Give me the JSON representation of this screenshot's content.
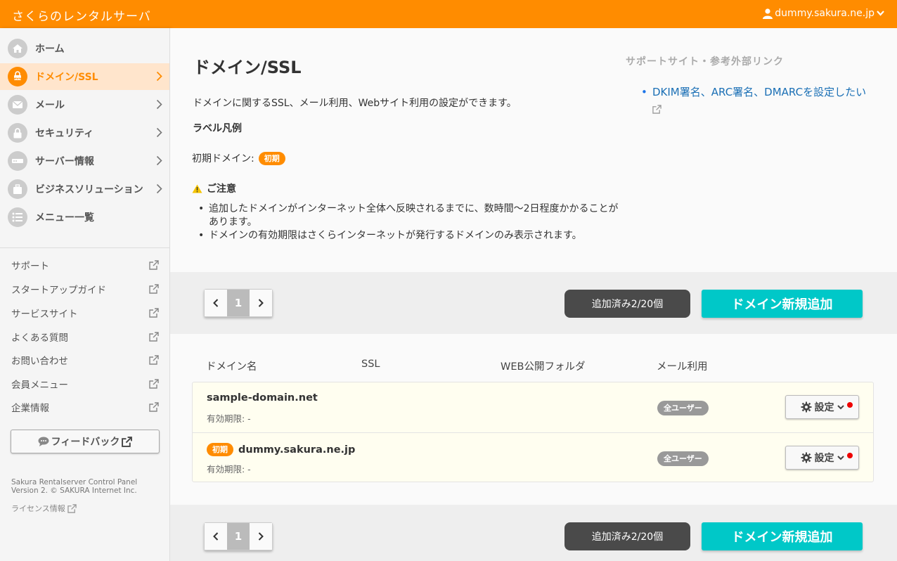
{
  "header": {
    "brand": "さくらのレンタルサーバ",
    "user": "dummy.sakura.ne.jp"
  },
  "sidebar": {
    "items": [
      {
        "label": "ホーム",
        "icon": "home-icon"
      },
      {
        "label": "ドメイン/SSL",
        "icon": "www-lock-icon",
        "active": true
      },
      {
        "label": "メール",
        "icon": "mail-icon"
      },
      {
        "label": "セキュリティ",
        "icon": "lock-icon"
      },
      {
        "label": "サーバー情報",
        "icon": "server-icon"
      },
      {
        "label": "ビジネスソリューション",
        "icon": "briefcase-icon"
      },
      {
        "label": "メニュー一覧",
        "icon": "list-icon"
      }
    ],
    "links": [
      "サポート",
      "スタートアップガイド",
      "サービスサイト",
      "よくある質問",
      "お問い合わせ",
      "会員メニュー",
      "企業情報"
    ],
    "feedback_label": "フィードバック",
    "footer_line1": "Sakura Rentalserver Control Panel",
    "footer_line2": "Version 2. © SAKURA Internet Inc.",
    "license_label": "ライセンス情報"
  },
  "main": {
    "title": "ドメイン/SSL",
    "description": "ドメインに関するSSL、メール利用、Webサイト利用の設定ができます。",
    "legend_title": "ラベル凡例",
    "initial_domain_label": "初期ドメイン:",
    "initial_badge": "初期",
    "notice_title": "ご注意",
    "notices": [
      "追加したドメインがインターネット全体へ反映されるまでに、数時間〜2日程度かかることがあります。",
      "ドメインの有効期限はさくらインターネットが発行するドメインのみ表示されます。"
    ],
    "support_title": "サポートサイト・参考外部リンク",
    "support_links": [
      "DKIM署名、ARC署名、DMARCを設定したい"
    ],
    "pager_page": "1",
    "count_label": "追加済み2/20個",
    "add_label": "ドメイン新規追加",
    "columns": [
      "ドメイン名",
      "SSL",
      "WEB公開フォルダ",
      "メール利用"
    ],
    "rows": [
      {
        "domain": "sample-domain.net",
        "expire": "有効期限: -",
        "mail": "全ユーザー",
        "settings": "設定",
        "initial": false
      },
      {
        "domain": "dummy.sakura.ne.jp",
        "expire": "有効期限: -",
        "mail": "全ユーザー",
        "settings": "設定",
        "initial": true,
        "initial_badge": "初期"
      }
    ]
  },
  "colors": {
    "brand": "#ff8c00",
    "add_button": "#00c8c8",
    "count_pill": "#4a4a4a",
    "link": "#1a6fb5"
  }
}
